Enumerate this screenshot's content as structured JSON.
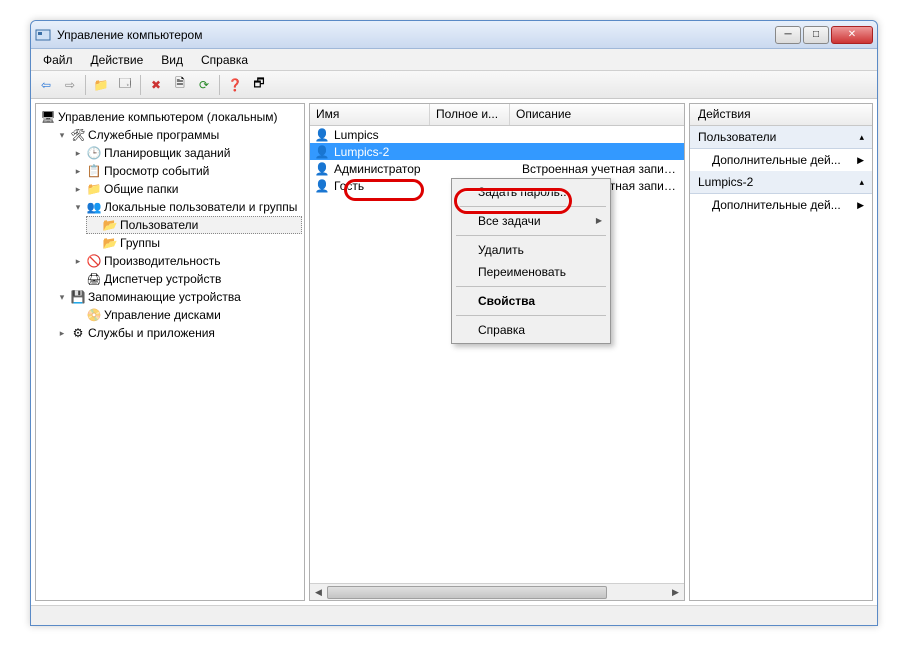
{
  "window": {
    "title": "Управление компьютером"
  },
  "menu": {
    "file": "Файл",
    "action": "Действие",
    "view": "Вид",
    "help": "Справка"
  },
  "tree": {
    "root": "Управление компьютером (локальным)",
    "sys_tools": "Служебные программы",
    "task_sched": "Планировщик заданий",
    "event_viewer": "Просмотр событий",
    "shared": "Общие папки",
    "local_users": "Локальные пользователи и группы",
    "users": "Пользователи",
    "groups": "Группы",
    "perf": "Производительность",
    "devmgr": "Диспетчер устройств",
    "storage": "Запоминающие устройства",
    "diskmgr": "Управление дисками",
    "services": "Службы и приложения"
  },
  "list": {
    "col_name": "Имя",
    "col_fullname": "Полное и...",
    "col_desc": "Описание",
    "rows": [
      {
        "name": "Lumpics",
        "full": "",
        "desc": ""
      },
      {
        "name": "Lumpics-2",
        "full": "",
        "desc": ""
      },
      {
        "name": "Администратор",
        "full": "",
        "desc": "Встроенная учетная запись администратора"
      },
      {
        "name": "Гость",
        "full": "",
        "desc": "Встроенная учетная запись гостя"
      }
    ]
  },
  "context": {
    "set_password": "Задать пароль...",
    "all_tasks": "Все задачи",
    "delete": "Удалить",
    "rename": "Переименовать",
    "properties": "Свойства",
    "help": "Справка"
  },
  "actions": {
    "header": "Действия",
    "group1": "Пользователи",
    "more1": "Дополнительные дей...",
    "group2": "Lumpics-2",
    "more2": "Дополнительные дей..."
  }
}
